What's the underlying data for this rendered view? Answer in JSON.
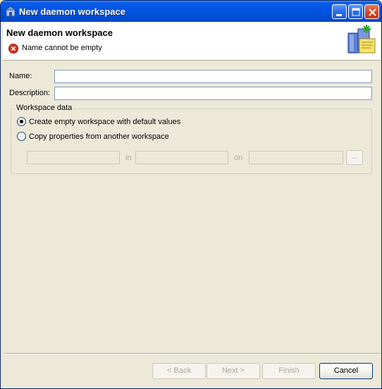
{
  "window": {
    "title": "New daemon workspace"
  },
  "banner": {
    "title": "New daemon workspace",
    "message": "Name cannot be empty",
    "message_icon": "error-icon",
    "art_icon": "workspace-wizard-icon"
  },
  "form": {
    "name_label": "Name:",
    "name_value": "",
    "description_label": "Description:",
    "description_value": "",
    "group_title": "Workspace data",
    "option_empty": "Create empty workspace with default values",
    "option_copy": "Copy properties from another workspace",
    "selected_option": "option_empty",
    "copy_workspace_value": "",
    "in_label": "in",
    "copy_daemon_value": "",
    "on_label": "on",
    "copy_machine_value": "",
    "browse_label": "..."
  },
  "buttons": {
    "back": "< Back",
    "next": "Next >",
    "finish": "Finish",
    "cancel": "Cancel"
  },
  "colors": {
    "titlebar": "#0054e3",
    "dialog_bg": "#ece9d8",
    "error_red": "#d8321e"
  }
}
